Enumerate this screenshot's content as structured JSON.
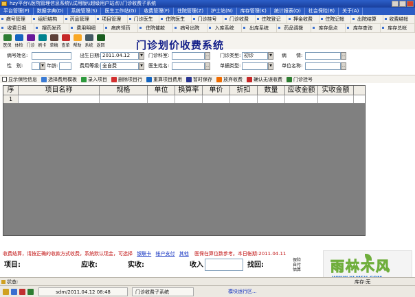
{
  "window": {
    "title": "hzy平台\\\\医院管理信息系统\\\\试用版\\\\超级用户站点\\\\门诊收费子系统"
  },
  "menubar": {
    "items": [
      "平台管理(P)",
      "数据字典(D)",
      "系统管理(S)",
      "医生工作站(G)",
      "收费管理(F)",
      "住院管理(Z)",
      "护士站(N)",
      "库存管理(K)",
      "统计报表(Q)",
      "社会保险(B)",
      "关于(A)"
    ]
  },
  "nav": {
    "row1": [
      "病号管理",
      "组织结构",
      "药品管理",
      "项目管理",
      "门诊医生",
      "住院医生",
      "门诊挂号",
      "门诊收费",
      "住院登记",
      "押金收费",
      "住院记帐",
      "出院结算",
      "收费结帐"
    ],
    "row2": [
      "收费日报",
      "摆药发药",
      "费用明细",
      "病房领药",
      "住院催款",
      "病号出院",
      "入库系统",
      "出库系统",
      "药品调拨",
      "库存盘点",
      "库存查询",
      "库存总帐"
    ]
  },
  "toolbar": {
    "buttons": [
      {
        "label": "医保",
        "color": "#2e7d32"
      },
      {
        "label": "体检",
        "color": "#1565c0"
      },
      {
        "label": "门诊",
        "color": "#6a1b9a"
      },
      {
        "label": "刷卡",
        "color": "#00838f"
      },
      {
        "label": "草稿",
        "color": "#5d4037"
      },
      {
        "label": "查单",
        "color": "#c62828"
      },
      {
        "label": "帮助",
        "color": "#f9a825"
      },
      {
        "label": "系统",
        "color": "#455a64"
      },
      {
        "label": "返回",
        "color": "#1b5e20"
      }
    ]
  },
  "page": {
    "title": "门诊划价收费系统"
  },
  "form": {
    "patient_name_label": "病号姓名:",
    "visit_date_label": "出生日期:",
    "visit_date_value": "2011.04.12",
    "dept_label": "门诊科室:",
    "visit_type_label": "门诊类型:",
    "visit_type_value": "初诊",
    "disease_label": "病　　情:",
    "gender_label": "性　别:",
    "age_label": "年龄:",
    "fee_level_label": "费用等级:",
    "fee_level_value": "全自费",
    "doctor_label": "医生姓名:",
    "form_type_label": "单据类型:",
    "unit_label": "单位名称:"
  },
  "actions": {
    "show_insurance": "显示保险信息",
    "select_template": "选择费用模板",
    "enter_item": "录入项目",
    "delete_item": "删除项目行",
    "reset_fee": "重算项目费用",
    "temp_save": "暂时保存",
    "cancel_fee": "放弃收费",
    "confirm_no_fee": "确认无误收费",
    "register": "门诊挂号"
  },
  "grid": {
    "columns": [
      "序",
      "项目名称",
      "规格",
      "单位",
      "换算率",
      "单价",
      "折扣",
      "数量",
      "应收金额",
      "实收金额"
    ],
    "rows": [
      {
        "idx": "1"
      }
    ]
  },
  "notice": {
    "text": "收费结算，请按正确的收款方式收费，系统默认现金，可选择",
    "link1": "银联卡",
    "link2": "帐户支付",
    "link3": "其他",
    "tail": "医保在算位数参考。本日帐期:2011.04.11"
  },
  "summary": {
    "items_label": "项目:",
    "receivable_label": "应收:",
    "actual_label": "实收:",
    "received_label": "收入",
    "change_label": "找回:",
    "insurance_label": "保险自付估算"
  },
  "logo": {
    "text": "雨林木风",
    "url": "WWW.YLMFU.COM"
  },
  "status": {
    "left": "状态:",
    "right": "库存:无"
  },
  "taskbar": {
    "user": "sdm/2011.04.12 08:48",
    "active_module": "门诊收费子系统",
    "module_link": "模块运行区..."
  }
}
